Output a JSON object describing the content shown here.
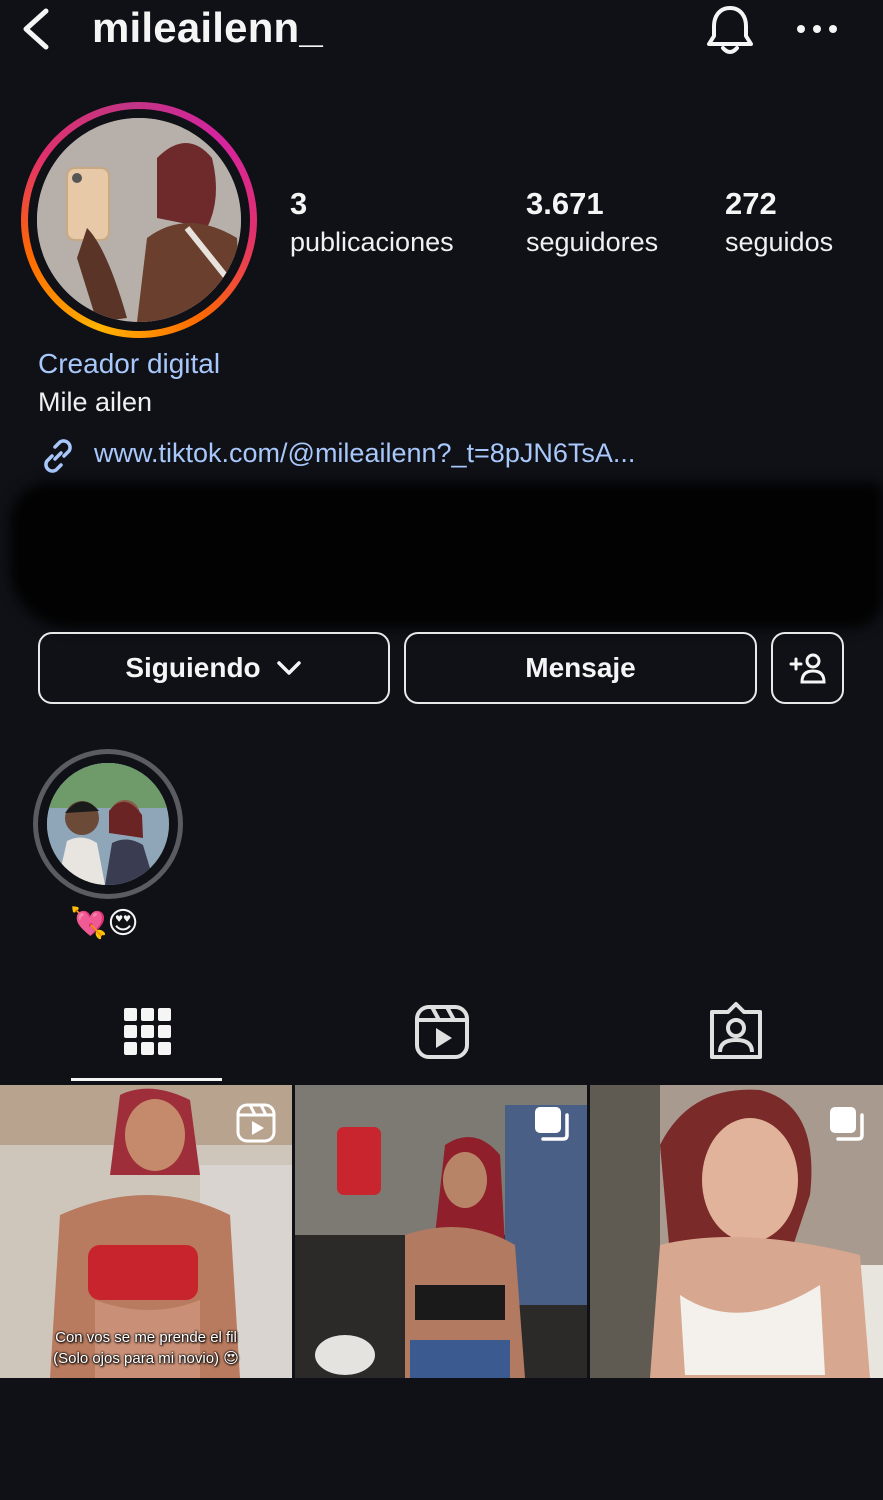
{
  "header": {
    "username": "mileailenn_",
    "back_icon": "chevron-left-icon",
    "bell_icon": "bell-icon",
    "more_icon": "more-horizontal-icon"
  },
  "profile": {
    "stats": [
      {
        "value": "3",
        "label": "publicaciones"
      },
      {
        "value": "3.671",
        "label": "seguidores"
      },
      {
        "value": "272",
        "label": "seguidos"
      }
    ],
    "category": "Creador digital",
    "name": "Mile ailen",
    "link": "www.tiktok.com/@mileailenn?_t=8pJN6TsA..."
  },
  "actions": {
    "follow_label": "Siguiendo",
    "message_label": "Mensaje",
    "suggest_icon": "add-person-icon"
  },
  "highlights": [
    {
      "label": "💘😍"
    }
  ],
  "tabs": [
    {
      "icon": "grid-icon",
      "active": true
    },
    {
      "icon": "reels-icon",
      "active": false
    },
    {
      "icon": "tagged-icon",
      "active": false
    }
  ],
  "posts": [
    {
      "type": "reel",
      "caption_line1": "Con vos se me prende el fil",
      "caption_line2": "(Solo ojos para mi novio) 😍"
    },
    {
      "type": "carousel"
    },
    {
      "type": "carousel"
    }
  ],
  "colors": {
    "background": "#0f1117",
    "link": "#a8c7fa",
    "text": "#f5f5f5"
  }
}
